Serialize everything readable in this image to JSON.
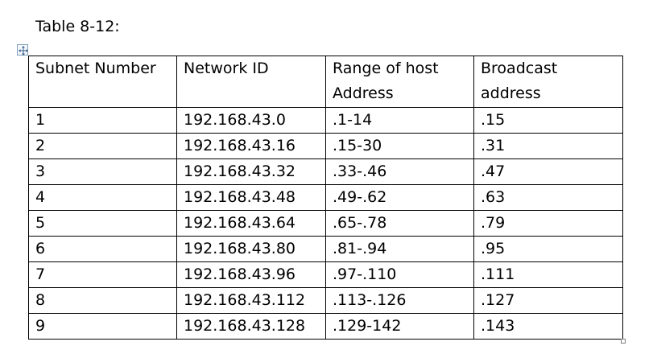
{
  "caption": "Table 8-12:",
  "icons": {
    "table_move_handle": "move-arrows-icon",
    "table_resize_handle": "resize-square-icon"
  },
  "table": {
    "headers": [
      "Subnet Number",
      "Network ID",
      "Range of host Address",
      "Broadcast address"
    ],
    "rows": [
      [
        "1",
        "192.168.43.0",
        ".1-14",
        ".15"
      ],
      [
        "2",
        "192.168.43.16",
        ".15-30",
        ".31"
      ],
      [
        "3",
        "192.168.43.32",
        ".33-.46",
        ".47"
      ],
      [
        "4",
        "192.168.43.48",
        ".49-.62",
        ".63"
      ],
      [
        "5",
        "192.168.43.64",
        ".65-.78",
        ".79"
      ],
      [
        "6",
        "192.168.43.80",
        ".81-.94",
        ".95"
      ],
      [
        "7",
        "192.168.43.96",
        ".97-.110",
        ".111"
      ],
      [
        "8",
        "192.168.43.112",
        ".113-.126",
        ".127"
      ],
      [
        "9",
        "192.168.43.128",
        ".129-142",
        ".143"
      ]
    ]
  }
}
